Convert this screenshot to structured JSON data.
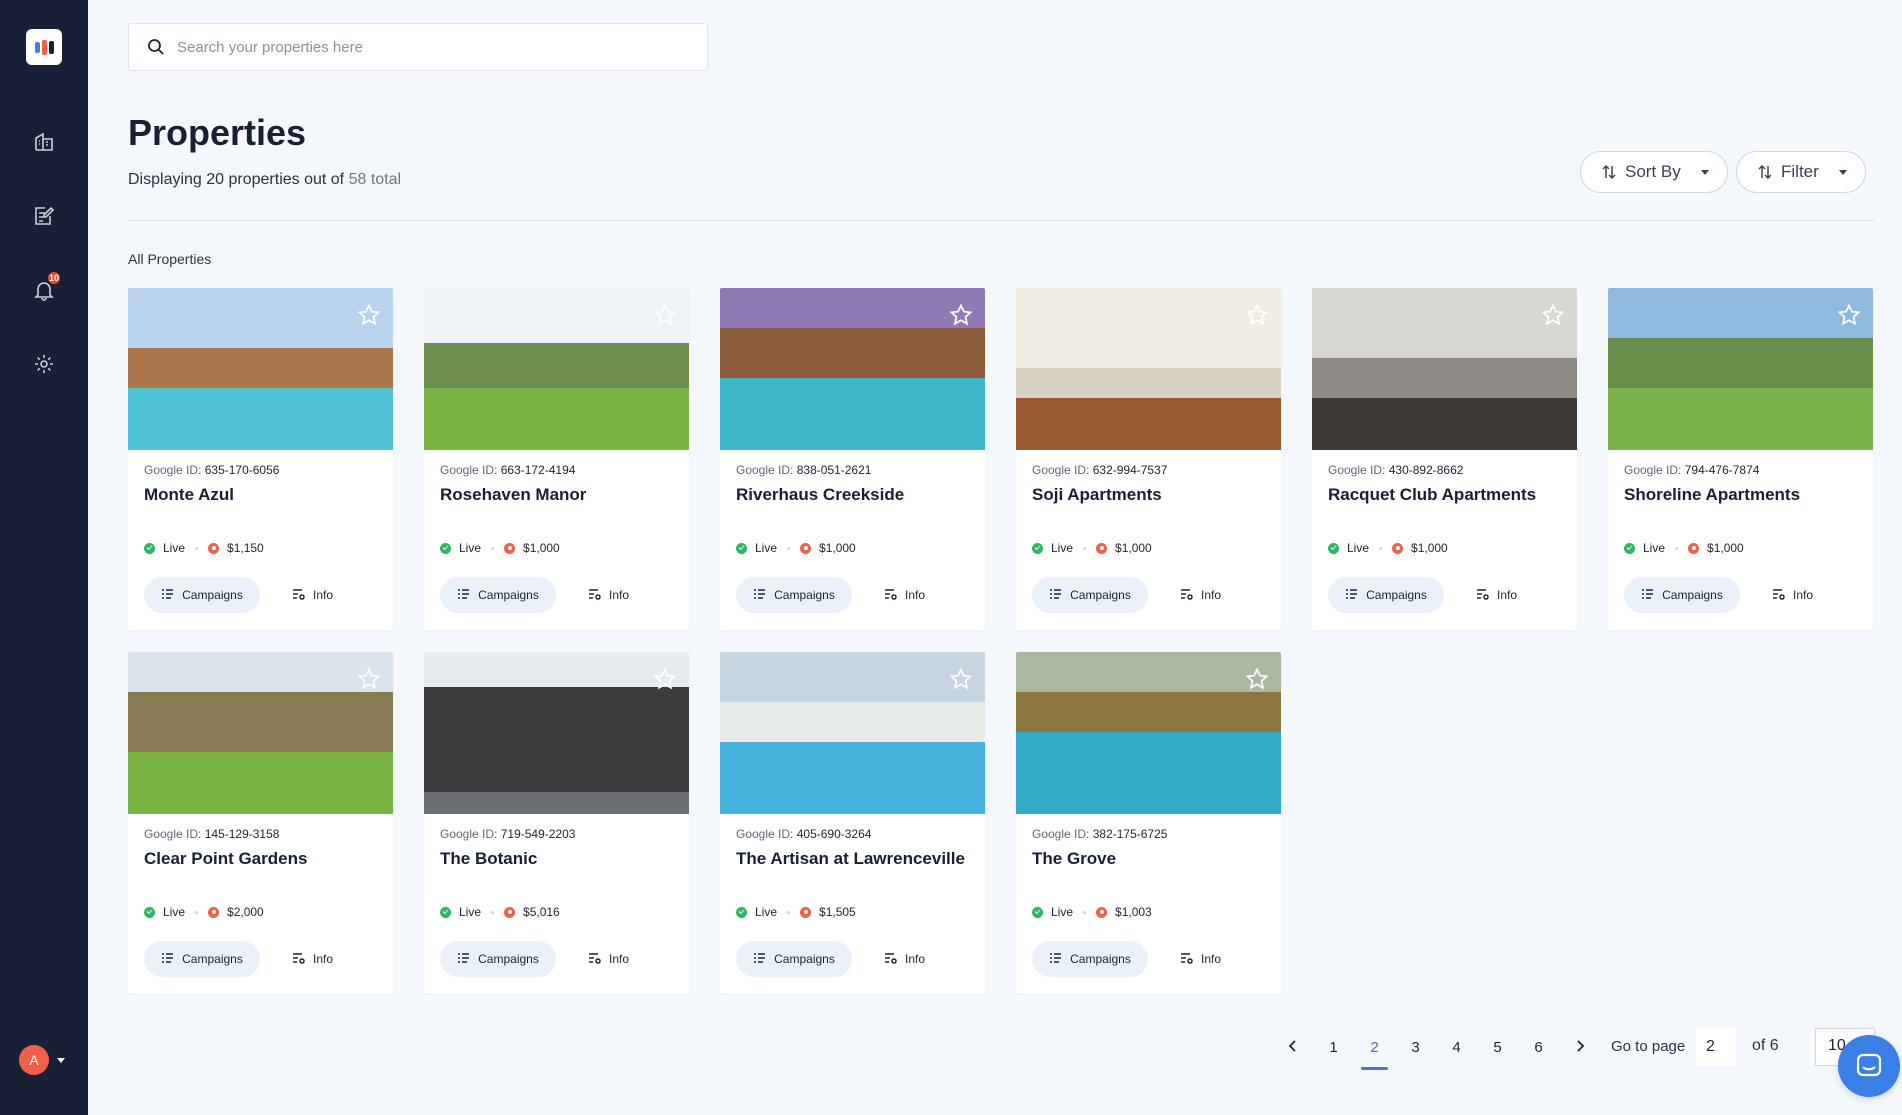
{
  "app": {
    "logo_colors": [
      "#3b82e4",
      "#f0604a",
      "#172035"
    ],
    "accent": "#4c6fe0",
    "sidebar_icons": [
      "properties-icon",
      "reports-icon",
      "bell-icon",
      "settings-icon"
    ],
    "notification_count": "10",
    "user_initial": "A"
  },
  "search": {
    "placeholder": "Search your properties here"
  },
  "header": {
    "title": "Properties",
    "subtitle_prefix": "Displaying 20 properties out of",
    "subtitle_total": "58 total",
    "sort_label": "Sort By",
    "filter_label": "Filter"
  },
  "section_label": "All Properties",
  "card_labels": {
    "google_id": "Google ID:",
    "status": "Live",
    "campaigns": "Campaigns",
    "info": "Info"
  },
  "properties": [
    {
      "name": "Monte Azul",
      "google_id": "635-170-6056",
      "price": "$1,150"
    },
    {
      "name": "Rosehaven Manor",
      "google_id": "663-172-4194",
      "price": "$1,000"
    },
    {
      "name": "Riverhaus Creekside",
      "google_id": "838-051-2621",
      "price": "$1,000"
    },
    {
      "name": "Soji Apartments",
      "google_id": "632-994-7537",
      "price": "$1,000"
    },
    {
      "name": "Racquet Club Apartments",
      "google_id": "430-892-8662",
      "price": "$1,000"
    },
    {
      "name": "Shoreline Apartments",
      "google_id": "794-476-7874",
      "price": "$1,000"
    },
    {
      "name": "Clear Point Gardens",
      "google_id": "145-129-3158",
      "price": "$2,000"
    },
    {
      "name": "The Botanic",
      "google_id": "719-549-2203",
      "price": "$5,016"
    },
    {
      "name": "The Artisan at Lawrenceville",
      "google_id": "405-690-3264",
      "price": "$1,505"
    },
    {
      "name": "The Grove",
      "google_id": "382-175-6725",
      "price": "$1,003"
    }
  ],
  "pagination": {
    "pages": [
      "1",
      "2",
      "3",
      "4",
      "5",
      "6"
    ],
    "current": "2",
    "goto_label": "Go to page",
    "goto_value": "2",
    "of_label": "of 6",
    "per_page": "10"
  }
}
